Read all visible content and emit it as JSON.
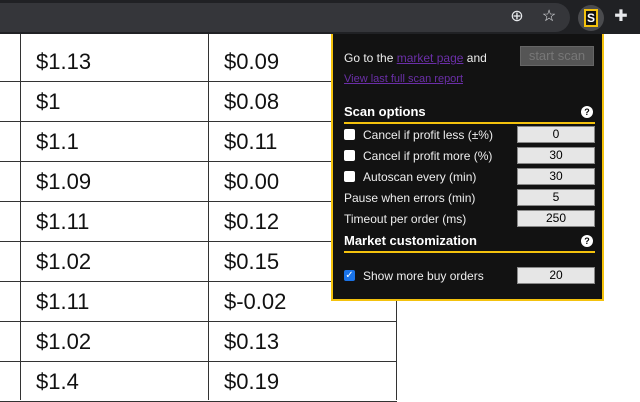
{
  "toolbar": {
    "icons": [
      "zoom-in-icon",
      "star-icon",
      "extension-s-icon",
      "puzzle-icon"
    ],
    "ext_letter": "S"
  },
  "table": {
    "rows": [
      [
        "$1.13",
        "$0.09"
      ],
      [
        "$1",
        "$0.08"
      ],
      [
        "$1.1",
        "$0.11"
      ],
      [
        "$1.09",
        "$0.00"
      ],
      [
        "$1.11",
        "$0.12"
      ],
      [
        "$1.02",
        "$0.15"
      ],
      [
        "$1.11",
        "$-0.02"
      ],
      [
        "$1.02",
        "$0.13"
      ],
      [
        "$1.4",
        "$0.19"
      ]
    ]
  },
  "popup": {
    "goto_prefix": "Go to the",
    "market_link": "market page",
    "goto_suffix": "and",
    "start_scan": "start scan",
    "report_link": "View last full scan report",
    "scan_options": "Scan options",
    "help": "?",
    "opts": [
      {
        "label": "Cancel if profit less (±%)",
        "value": "0",
        "checked": false
      },
      {
        "label": "Cancel if profit more (%)",
        "value": "30",
        "checked": false
      },
      {
        "label": "Autoscan every (min)",
        "value": "30",
        "checked": false
      },
      {
        "label": "Pause when errors (min)",
        "value": "5"
      },
      {
        "label": "Timeout per order (ms)",
        "value": "250"
      }
    ],
    "market_custom": "Market customization",
    "show_more": {
      "label": "Show more buy orders",
      "value": "20",
      "checked": true
    }
  }
}
